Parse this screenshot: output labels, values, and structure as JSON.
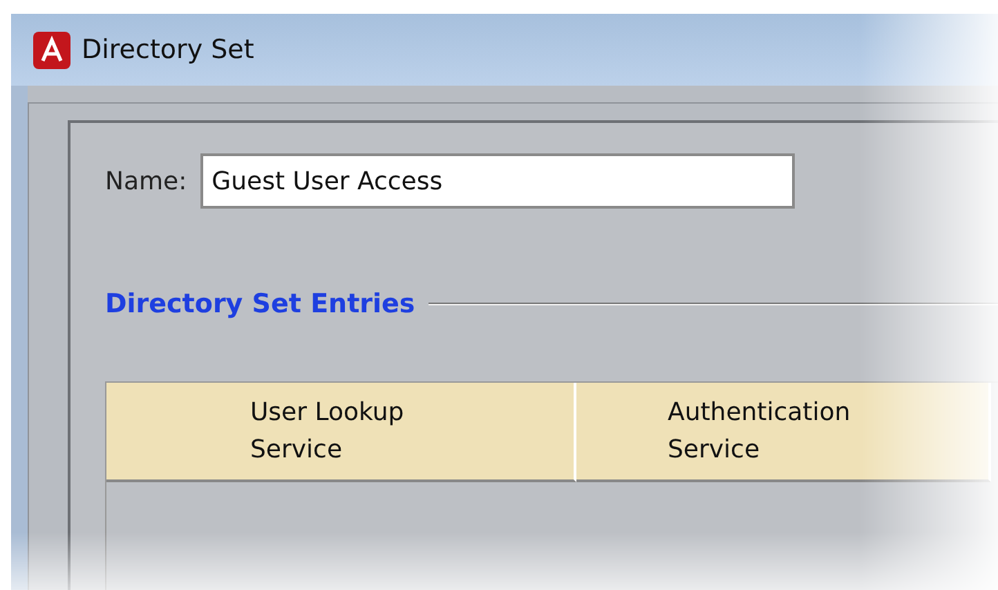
{
  "window": {
    "title": "Directory Set"
  },
  "name_field": {
    "label": "Name:",
    "value": "Guest User Access"
  },
  "section": {
    "title": "Directory Set Entries"
  },
  "table": {
    "columns": [
      {
        "lines": [
          "User Lookup",
          "Service"
        ]
      },
      {
        "lines": [
          "Authentication",
          "Service"
        ]
      }
    ]
  }
}
